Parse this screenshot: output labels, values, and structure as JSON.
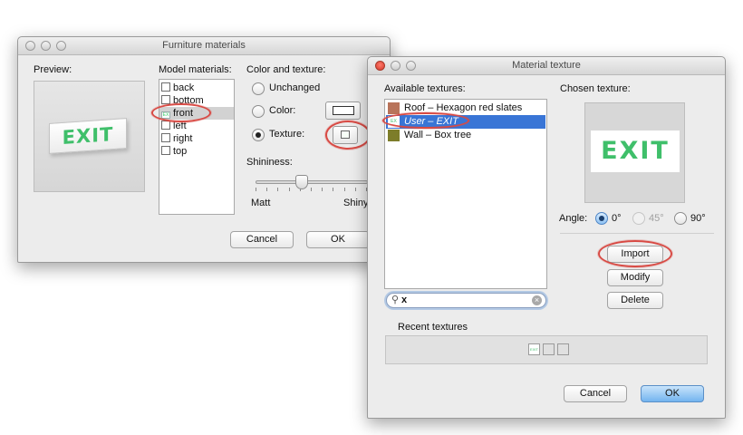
{
  "furniture_window": {
    "title": "Furniture materials",
    "preview_label": "Preview:",
    "preview_text": "EXIT",
    "model_materials_label": "Model materials:",
    "materials": [
      {
        "name": "back",
        "selected": false
      },
      {
        "name": "bottom",
        "selected": false
      },
      {
        "name": "front",
        "selected": true
      },
      {
        "name": "left",
        "selected": false
      },
      {
        "name": "right",
        "selected": false
      },
      {
        "name": "top",
        "selected": false
      }
    ],
    "color_texture_label": "Color and texture:",
    "unchanged_label": "Unchanged",
    "color_label": "Color:",
    "texture_label": "Texture:",
    "selected_option": "Texture",
    "shininess_label": "Shininess:",
    "matt_label": "Matt",
    "shiny_label": "Shiny",
    "shininess_value": 0.4,
    "cancel_label": "Cancel",
    "ok_label": "OK"
  },
  "texture_window": {
    "title": "Material texture",
    "available_label": "Available textures:",
    "textures": [
      {
        "name": "Roof – Hexagon red slates",
        "color": "#b8735a",
        "selected": false
      },
      {
        "name": "User – EXIT",
        "color": "#ffffff",
        "selected": true
      },
      {
        "name": "Wall – Box tree",
        "color": "#7d7d2a",
        "selected": false
      }
    ],
    "chosen_label": "Chosen texture:",
    "chosen_text": "EXIT",
    "angle_label": "Angle:",
    "angles": [
      {
        "label": "0°",
        "selected": true,
        "enabled": true
      },
      {
        "label": "45°",
        "selected": false,
        "enabled": false
      },
      {
        "label": "90°",
        "selected": false,
        "enabled": true
      }
    ],
    "import_label": "Import",
    "modify_label": "Modify",
    "delete_label": "Delete",
    "search_value": "x",
    "recent_label": "Recent textures",
    "recent_exit_text": "EXIT",
    "cancel_label": "Cancel",
    "ok_label": "OK"
  },
  "colors": {
    "selection_blue": "#3975d6",
    "annotation_red": "#d84a44",
    "exit_green": "#3fbf6a",
    "window_bg": "#ececec"
  }
}
